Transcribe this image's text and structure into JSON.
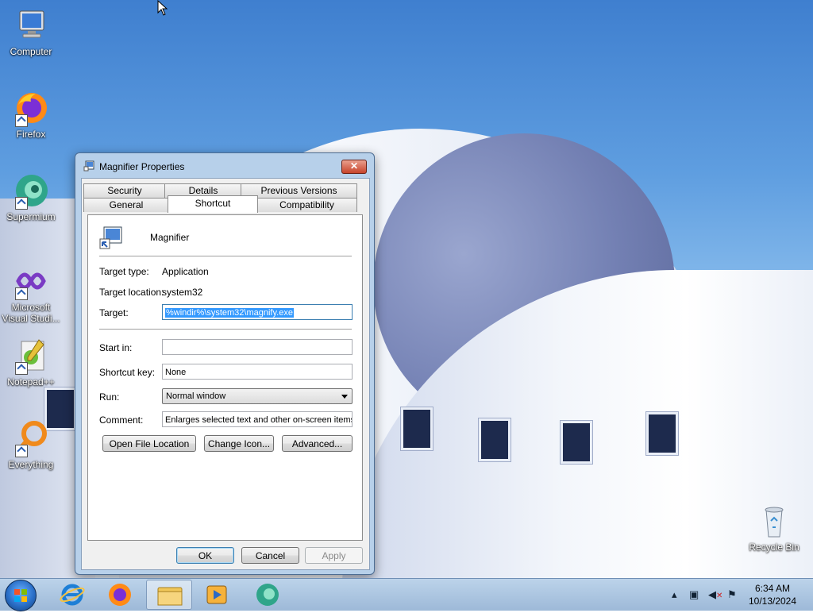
{
  "desktop": {
    "icons": [
      {
        "label": "Computer"
      },
      {
        "label": "Firefox"
      },
      {
        "label": "Supermium"
      },
      {
        "label": "Microsoft Visual Studi..."
      },
      {
        "label": "Notepad++"
      },
      {
        "label": "Everything"
      },
      {
        "label": "Recycle Bin"
      }
    ]
  },
  "dialog": {
    "title": "Magnifier Properties",
    "close_label": "✕",
    "tabs_top": [
      "Security",
      "Details",
      "Previous Versions"
    ],
    "tabs_bottom": [
      "General",
      "Shortcut",
      "Compatibility"
    ],
    "active_tab": "Shortcut",
    "app_name": "Magnifier",
    "target_type_label": "Target type:",
    "target_type_value": "Application",
    "target_location_label": "Target location:",
    "target_location_value": "system32",
    "target_label": "Target:",
    "target_value": "%windir%\\system32\\magnify.exe",
    "start_in_label": "Start in:",
    "start_in_value": "",
    "shortcut_key_label": "Shortcut key:",
    "shortcut_key_value": "None",
    "run_label": "Run:",
    "run_value": "Normal window",
    "comment_label": "Comment:",
    "comment_value": "Enlarges selected text and other on-screen items f",
    "open_file_location": "Open File Location",
    "change_icon": "Change Icon...",
    "advanced": "Advanced...",
    "ok": "OK",
    "cancel": "Cancel",
    "apply": "Apply"
  },
  "taskbar": {
    "time": "6:34 AM",
    "date": "10/13/2024",
    "pinned": [
      "internet-explorer",
      "firefox",
      "file-explorer",
      "media-player",
      "supermium"
    ]
  }
}
